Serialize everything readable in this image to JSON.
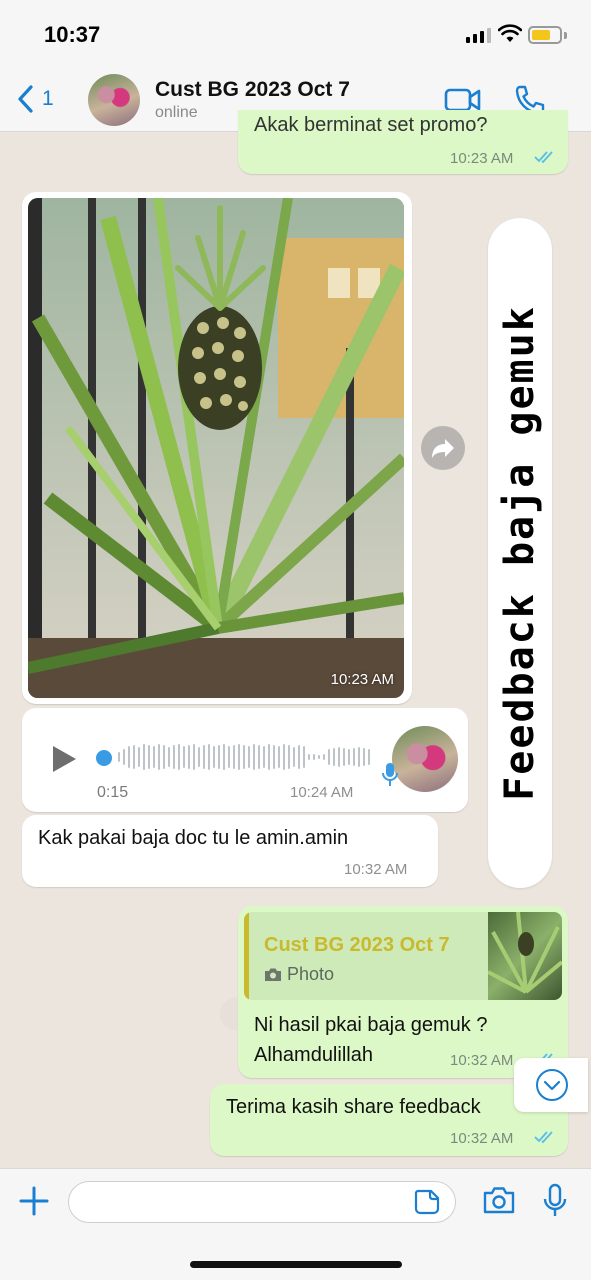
{
  "status_bar": {
    "time": "10:37"
  },
  "header": {
    "back_count": "1",
    "contact_name": "Cust BG 2023 Oct 7",
    "contact_status": "online"
  },
  "messages": {
    "partial_out": {
      "text": "Akak berminat set promo?",
      "time": "10:23 AM"
    },
    "photo": {
      "time": "10:23 AM"
    },
    "voice": {
      "duration": "0:15",
      "time": "10:24 AM"
    },
    "kak": {
      "text": "Kak pakai baja doc tu le amin.amin",
      "time": "10:32 AM"
    },
    "reply": {
      "quoted_name": "Cust BG 2023 Oct 7",
      "quoted_type": "Photo",
      "line1": "Ni hasil pkai baja gemuk ?",
      "line2": "Alhamdulillah",
      "time": "10:32 AM"
    },
    "terima": {
      "text": "Terima kasih share feedback",
      "time": "10:32 AM"
    }
  },
  "overlay": {
    "caption": "Feedback baja gemuk"
  },
  "input": {
    "placeholder": ""
  },
  "colors": {
    "accent": "#1a7fd0",
    "outgoing_bubble": "#dcf8c6",
    "incoming_bubble": "#ffffff",
    "quote_name": "#c9b92c",
    "read_ticks": "#53bdeb"
  }
}
